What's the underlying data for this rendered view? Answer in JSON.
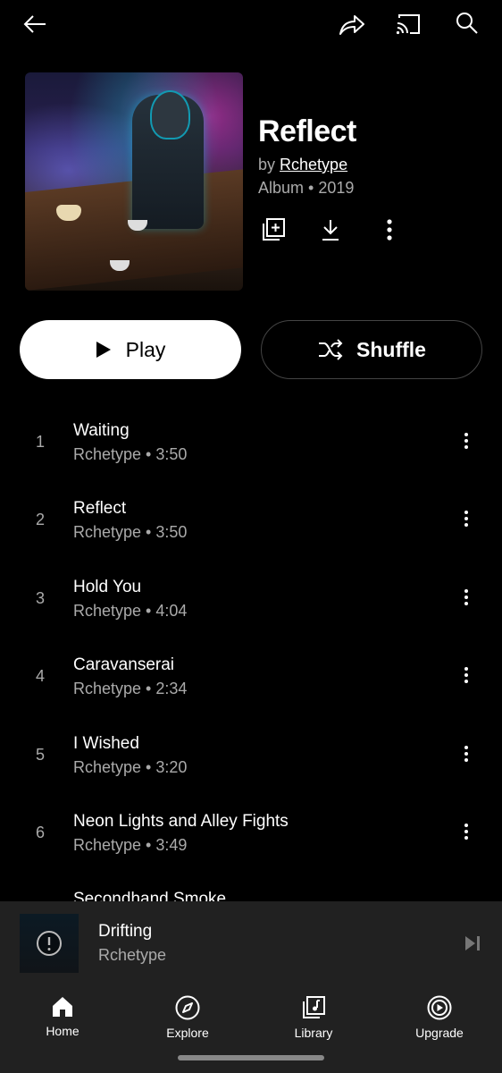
{
  "topbar": {
    "back_icon": "arrow-left-icon",
    "share_icon": "share-icon",
    "cast_icon": "cast-icon",
    "search_icon": "search-icon"
  },
  "album": {
    "title": "Reflect",
    "by_prefix": "by",
    "artist": "Rchetype",
    "meta": "Album • 2019",
    "actions": [
      "add-to-library-icon",
      "download-icon",
      "more-vert-icon"
    ]
  },
  "buttons": {
    "play_label": "Play",
    "shuffle_label": "Shuffle"
  },
  "tracks": [
    {
      "num": "1",
      "title": "Waiting",
      "sub": "Rchetype • 3:50"
    },
    {
      "num": "2",
      "title": "Reflect",
      "sub": "Rchetype • 3:50"
    },
    {
      "num": "3",
      "title": "Hold You",
      "sub": "Rchetype • 4:04"
    },
    {
      "num": "4",
      "title": "Caravanserai",
      "sub": "Rchetype • 2:34"
    },
    {
      "num": "5",
      "title": "I Wished",
      "sub": "Rchetype • 3:20"
    },
    {
      "num": "6",
      "title": "Neon Lights and Alley Fights",
      "sub": "Rchetype • 3:49"
    },
    {
      "num": "",
      "title": "Secondhand Smoke",
      "sub": ""
    }
  ],
  "miniplayer": {
    "title": "Drifting",
    "artist": "Rchetype"
  },
  "nav": {
    "items": [
      {
        "label": "Home",
        "icon": "home-icon"
      },
      {
        "label": "Explore",
        "icon": "compass-icon"
      },
      {
        "label": "Library",
        "icon": "library-icon"
      },
      {
        "label": "Upgrade",
        "icon": "upgrade-icon"
      }
    ]
  }
}
